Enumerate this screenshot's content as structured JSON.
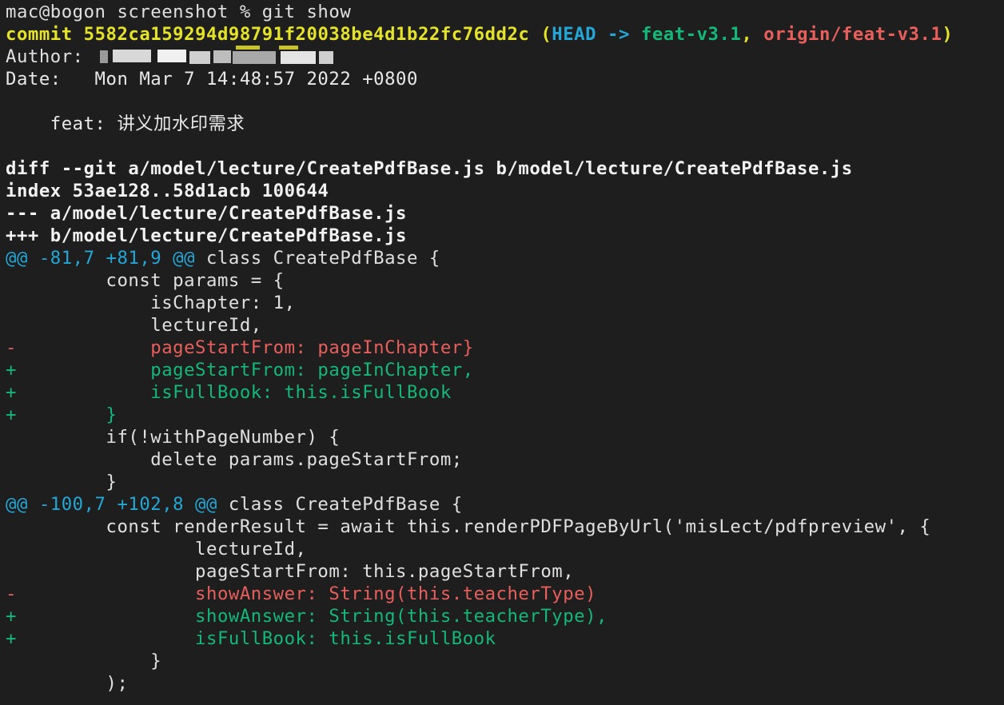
{
  "terminal": {
    "prompt": "mac@bogon screenshot % git show",
    "commit": {
      "label": "commit",
      "hash": "5582ca159294d98791f20038be4d1b22fc76dd2c",
      "open_paren": "(",
      "head": "HEAD",
      "arrow": "->",
      "branch": "feat-v3.1",
      "comma": ",",
      "remote": "origin/feat-v3.1",
      "close_paren": ")"
    },
    "author_label": "Author:",
    "date_line": "Date:   Mon Mar 7 14:48:57 2022 +0800",
    "message": "    feat: 讲义加水印需求",
    "diff_header": [
      "diff --git a/model/lecture/CreatePdfBase.js b/model/lecture/CreatePdfBase.js",
      "index 53ae128..58d1acb 100644",
      "--- a/model/lecture/CreatePdfBase.js",
      "+++ b/model/lecture/CreatePdfBase.js"
    ],
    "hunks": [
      {
        "marker": "@@ -81,7 +81,9 @@",
        "context": " class CreatePdfBase {",
        "lines": [
          {
            "prefix": " ",
            "text": "        const params = {",
            "type": "context"
          },
          {
            "prefix": " ",
            "text": "            isChapter: 1,",
            "type": "context"
          },
          {
            "prefix": " ",
            "text": "            lectureId,",
            "type": "context"
          },
          {
            "prefix": "-",
            "text": "            pageStartFrom: pageInChapter}",
            "type": "del"
          },
          {
            "prefix": "+",
            "text": "            pageStartFrom: pageInChapter,",
            "type": "add"
          },
          {
            "prefix": "+",
            "text": "            isFullBook: this.isFullBook",
            "type": "add"
          },
          {
            "prefix": "+",
            "text": "        }",
            "type": "add"
          },
          {
            "prefix": " ",
            "text": "        if(!withPageNumber) {",
            "type": "context"
          },
          {
            "prefix": " ",
            "text": "            delete params.pageStartFrom;",
            "type": "context"
          },
          {
            "prefix": " ",
            "text": "        }",
            "type": "context"
          }
        ]
      },
      {
        "marker": "@@ -100,7 +102,8 @@",
        "context": " class CreatePdfBase {",
        "lines": [
          {
            "prefix": " ",
            "text": "        const renderResult = await this.renderPDFPageByUrl('misLect/pdfpreview', {",
            "type": "context"
          },
          {
            "prefix": " ",
            "text": "                lectureId,",
            "type": "context"
          },
          {
            "prefix": " ",
            "text": "                pageStartFrom: this.pageStartFrom,",
            "type": "context"
          },
          {
            "prefix": "-",
            "text": "                showAnswer: String(this.teacherType)",
            "type": "del"
          },
          {
            "prefix": "+",
            "text": "                showAnswer: String(this.teacherType),",
            "type": "add"
          },
          {
            "prefix": "+",
            "text": "                isFullBook: this.isFullBook",
            "type": "add"
          },
          {
            "prefix": " ",
            "text": "            }",
            "type": "context"
          },
          {
            "prefix": " ",
            "text": "        );",
            "type": "context"
          }
        ]
      }
    ]
  }
}
